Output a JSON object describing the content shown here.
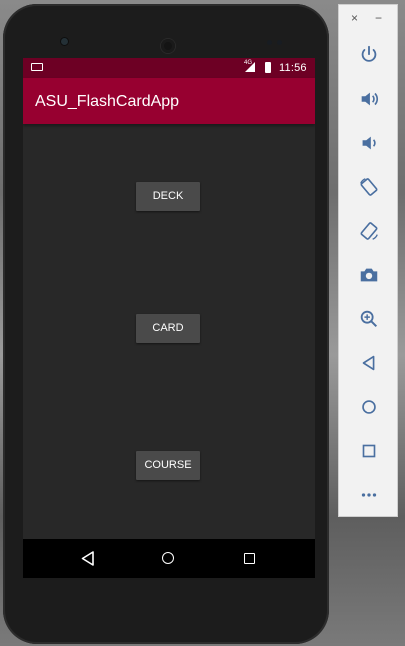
{
  "app": {
    "title": "ASU_FlashCardApp"
  },
  "status_bar": {
    "time": "11:56",
    "network": "4G"
  },
  "main": {
    "buttons": [
      {
        "label": "DECK"
      },
      {
        "label": "CARD"
      },
      {
        "label": "COURSE"
      }
    ]
  },
  "emulator_toolbar": {
    "close": "×",
    "minimize": "−",
    "icons": [
      "power-icon",
      "volume-up-icon",
      "volume-down-icon",
      "rotate-left-icon",
      "rotate-right-icon",
      "camera-icon",
      "zoom-icon",
      "back-icon",
      "home-icon",
      "overview-icon",
      "more-icon"
    ]
  },
  "colors": {
    "app_bar": "#970030",
    "status_bar": "#6d0024",
    "background": "#282828",
    "button": "#4a4a4a"
  }
}
